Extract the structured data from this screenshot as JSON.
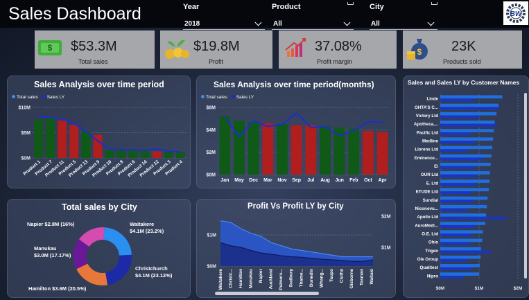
{
  "header": {
    "title": "Sales Dashboard",
    "filters": [
      {
        "label": "Year",
        "value": "2018"
      },
      {
        "label": "Product",
        "value": "All"
      },
      {
        "label": "City",
        "value": "All"
      }
    ],
    "logo_text": "BW"
  },
  "kpis": [
    {
      "value": "$53.3M",
      "label": "Total sales",
      "icon": "money-icon"
    },
    {
      "value": "$19.8M",
      "label": "Profit",
      "icon": "coins-plant-icon"
    },
    {
      "value": "37.08%",
      "label": "Profit margin",
      "icon": "growth-chart-icon"
    },
    {
      "value": "23K",
      "label": "Products sold",
      "icon": "money-bag-icon"
    }
  ],
  "colors": {
    "total_sales_green": "#0f5a17",
    "total_sales_red": "#b01e1e",
    "sales_ly_line": "#1a2ecf",
    "legend_total": "#3a8fe8",
    "legend_ly": "#1a2ecf",
    "bar_blue": "#1f6fe0",
    "bar_blue_ly": "#1a35c4",
    "area_fill": "#2a56c8"
  },
  "chart_data": [
    {
      "type": "bar",
      "title": "Sales Analysis over time period",
      "legend": [
        "Total sales",
        "Sales LY"
      ],
      "categories": [
        "Product 1",
        "Product 7",
        "Product 11",
        "Product 5",
        "Product 13",
        "Product 9",
        "Product 10",
        "Product 8",
        "Product 6",
        "Product 14",
        "Product 12",
        "Product 3",
        "Product 4"
      ],
      "series": [
        {
          "name": "Total sales",
          "values": [
            7.6,
            8.0,
            7.4,
            6.5,
            5.3,
            4.6,
            1.6,
            1.6,
            1.5,
            1.4,
            1.3,
            1.2,
            1.1
          ]
        },
        {
          "name": "Sales LY",
          "values": [
            8.2,
            8.0,
            7.7,
            6.9,
            5.2,
            3.4,
            1.8,
            1.6,
            1.6,
            1.5,
            1.8,
            1.3,
            1.2
          ]
        }
      ],
      "colors": [
        "green",
        "green",
        "red",
        "red",
        "green",
        "red",
        "green",
        "green",
        "green",
        "green",
        "red",
        "green",
        "green"
      ],
      "yticks": [
        "$0M",
        "$5M",
        "$10M"
      ],
      "ylim": [
        0,
        10
      ]
    },
    {
      "type": "bar",
      "title": "Sales Analysis over time period(months)",
      "legend": [
        "Total sales",
        "Sales LY"
      ],
      "categories": [
        "Jan",
        "May",
        "Dec",
        "Mar",
        "Nov",
        "Sep",
        "Jul",
        "Aug",
        "Jun",
        "Feb",
        "Oct",
        "Apr"
      ],
      "series": [
        {
          "name": "Total sales",
          "values": [
            5.2,
            4.8,
            4.7,
            4.6,
            4.5,
            4.4,
            4.4,
            4.3,
            4.2,
            4.1,
            3.9,
            3.8
          ]
        },
        {
          "name": "Sales LY",
          "values": [
            5.1,
            3.4,
            4.8,
            4.3,
            4.5,
            5.5,
            4.2,
            4.3,
            3.5,
            3.9,
            4.7,
            4.7
          ]
        }
      ],
      "colors": [
        "green",
        "green",
        "green",
        "red",
        "green",
        "red",
        "red",
        "green",
        "green",
        "green",
        "red",
        "red"
      ],
      "yticks": [
        "$0M",
        "$2M",
        "$4M",
        "$6M"
      ],
      "ylim": [
        0,
        6
      ]
    },
    {
      "type": "pie",
      "title": "Total sales by City",
      "slices": [
        {
          "label": "Waitakere",
          "text": "$4.1M (23.2%)",
          "value": 23.2,
          "color": "#2b8ff0"
        },
        {
          "label": "Christchurch",
          "text": "$4.1M (23.12%)",
          "value": 23.12,
          "color": "#1c2aa8"
        },
        {
          "label": "Hamilton",
          "text": "$3.6M (20.5%)",
          "value": 20.5,
          "color": "#e8773a"
        },
        {
          "label": "Manukau",
          "text": "$3.0M (17.17%)",
          "value": 17.17,
          "color": "#6a1898"
        },
        {
          "label": "Napier",
          "text": "$2.8M (16%)",
          "value": 16,
          "color": "#d54bb0"
        }
      ]
    },
    {
      "type": "area",
      "title": "Profit Vs Profit LY by City",
      "categories": [
        "Waitakere",
        "Christc...",
        "Hamilton",
        "Manukau",
        "Napier",
        "Auckland",
        "Palmers...",
        "Sudbury",
        "Thame...",
        "Dunedin",
        "Whang...",
        "Taupo",
        "Clutha",
        "Gisborne",
        "Tasman",
        "Waitaki"
      ],
      "series": [
        {
          "name": "Profit",
          "values": [
            1.45,
            1.4,
            1.2,
            1.05,
            0.95,
            0.75,
            0.65,
            0.55,
            0.5,
            0.45,
            0.4,
            0.35,
            0.3,
            0.3,
            0.3,
            0.3
          ]
        },
        {
          "name": "Profit LY",
          "values": [
            0.75,
            0.65,
            0.6,
            0.5,
            0.42,
            0.38,
            0.33,
            0.3,
            0.28,
            0.25,
            0.22,
            0.2,
            0.18,
            0.15,
            0.15,
            0.2
          ]
        }
      ],
      "yticks_left": [
        "$0M",
        "$1M"
      ],
      "yticks_right": [
        "$1M",
        "$2M"
      ],
      "ylim": [
        0,
        1.6
      ]
    },
    {
      "type": "bar",
      "title": "Sales and Sales LY by Customer Names",
      "orientation": "horizontal",
      "categories": [
        "Linde",
        "OHTA'S C...",
        "Victory Ltd",
        "Apotheca,...",
        "Pacific Ltd",
        "Medline",
        "Llorens Ltd",
        "Eminence...",
        "Ei",
        "OUR Ltd",
        "E. Ltd",
        "ETUDE Ltd",
        "Sundial",
        "Niconovu...",
        "Apollo Ltd",
        "AuroMedi...",
        "O.E. Ltd",
        "Ohio",
        "Trigen",
        "Ole Group",
        "Qualitest",
        "Nipro"
      ],
      "series": [
        {
          "name": "Sales",
          "values": [
            1.6,
            1.5,
            1.45,
            1.4,
            1.38,
            1.36,
            1.34,
            1.32,
            1.3,
            1.28,
            1.27,
            1.25,
            1.22,
            1.2,
            1.18,
            1.16,
            1.1,
            1.08,
            1.05,
            1.04,
            1.02,
            1.0
          ]
        },
        {
          "name": "Sales LY",
          "values": [
            0.9,
            1.5,
            1.0,
            1.45,
            0.8,
            0.9,
            0.7,
            1.1,
            0.9,
            0.95,
            0.9,
            0.8,
            0.85,
            0.7,
            1.7,
            0.9,
            0.8,
            0.75,
            1.3,
            0.7,
            0.8,
            0.6
          ]
        }
      ],
      "xticks": [
        "$0M",
        "$1M",
        "$2M"
      ],
      "xlim": [
        0,
        2
      ]
    }
  ]
}
